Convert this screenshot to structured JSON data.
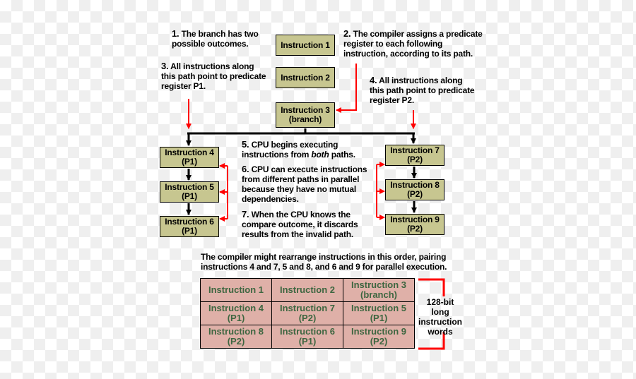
{
  "notes": [
    {
      "num": "1.",
      "text": "The branch has two",
      "text2": "possible outcomes."
    },
    {
      "num": "2.",
      "text": "The compiler assigns a predicate",
      "text2": "register to each following",
      "text3": "instruction, according to its path."
    },
    {
      "num": "3.",
      "text": "All instructions along",
      "text2": "this path point to predicate",
      "text3": "register P1."
    },
    {
      "num": "4.",
      "text": "All instructions along",
      "text2": "this path point to predicate",
      "text3": "register P2."
    },
    {
      "num": "5.",
      "text": "CPU begins executing",
      "text2a": "instructions from ",
      "text2b": "both",
      "text2c": " paths."
    },
    {
      "num": "6.",
      "text": "CPU can execute instructions",
      "text2": "from different paths in parallel",
      "text3": "because they have no mutual",
      "text4": "dependencies."
    },
    {
      "num": "7.",
      "text": "When the CPU knows the",
      "text2": "compare outcome, it discards",
      "text3": "results from the invalid path."
    }
  ],
  "boxes": [
    {
      "l1": "Instruction 1"
    },
    {
      "l1": "Instruction 2"
    },
    {
      "l1": "Instruction 3",
      "l2": "(branch)"
    },
    {
      "l1": "Instruction 4",
      "l2": "(P1)"
    },
    {
      "l1": "Instruction 5",
      "l2": "(P1)"
    },
    {
      "l1": "Instruction 6",
      "l2": "(P1)"
    },
    {
      "l1": "Instruction 7",
      "l2": "(P2)"
    },
    {
      "l1": "Instruction 8",
      "l2": "(P2)"
    },
    {
      "l1": "Instruction 9",
      "l2": "(P2)"
    }
  ],
  "caption": {
    "l1": "The compiler might rearrange instructions in this order, pairing",
    "l2": "instructions 4 and 7, 5 and 8, and 6 and 9 for parallel execution."
  },
  "table": [
    [
      {
        "l1": "Instruction 1"
      },
      {
        "l1": "Instruction 2"
      },
      {
        "l1": "Instruction 3",
        "l2": "(branch)"
      }
    ],
    [
      {
        "l1": "Instruction 4",
        "l2": "(P1)"
      },
      {
        "l1": "Instruction 7",
        "l2": "(P2)"
      },
      {
        "l1": "Instruction 5",
        "l2": "(P1)"
      }
    ],
    [
      {
        "l1": "Instruction 8",
        "l2": "(P2)"
      },
      {
        "l1": "Instruction 6",
        "l2": "(P1)"
      },
      {
        "l1": "Instruction 9",
        "l2": "(P2)"
      }
    ]
  ],
  "word_label": {
    "l1": "128-bit long",
    "l2": "instruction",
    "l3": "words"
  },
  "colors": {
    "box": "#c7c690",
    "table": "#dfb0a8",
    "table_text": "#3d6640",
    "arrow_red": "#ff0000"
  }
}
